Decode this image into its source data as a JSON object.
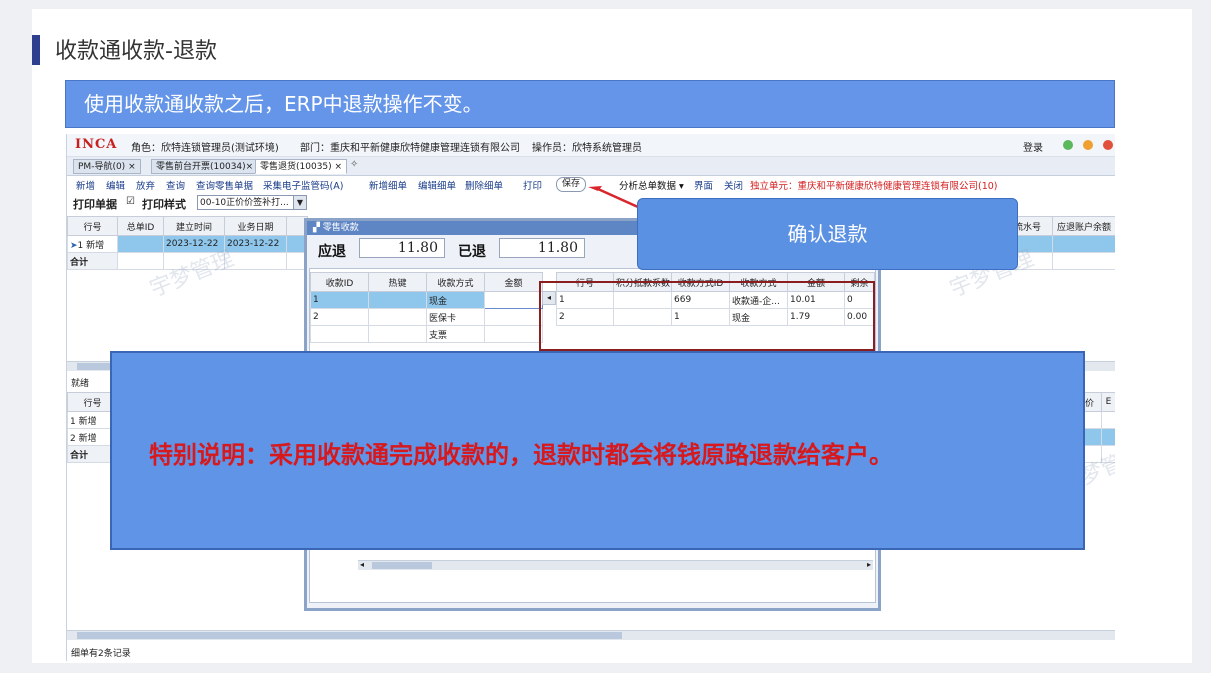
{
  "slide": {
    "title": "收款通收款-退款",
    "banner": "使用收款通收款之后，ERP中退款操作不变。",
    "callout": "确认退款",
    "note": "特别说明：采用收款通完成收款的，退款时都会将钱原路退款给客户。"
  },
  "colors": {
    "banner": "#6495e8",
    "note_text": "#d7191e",
    "logo": "#c8201e",
    "arrow": "#d9262c"
  },
  "app": {
    "logo": "INCA",
    "role": "角色：欣特连锁管理员(测试环境)",
    "dept": "部门：重庆和平新健康欣特健康管理连锁有限公司",
    "operator": "操作员：欣特系统管理员",
    "login": "登录",
    "tabs": [
      "PM-导航(0)",
      "零售前台开票(10034)",
      "零售退货(10035)"
    ],
    "toolbar": [
      "新增",
      "编辑",
      "放弃",
      "查询",
      "查询零售单据",
      "采集电子监管码(A)",
      "新增细单",
      "编辑细单",
      "删除细单",
      "打印"
    ],
    "save": "保存",
    "analysis": "分析总单数据",
    "ui": "界面",
    "close": "关闭",
    "unit": "独立单元：重庆和平新健康欣特健康管理连锁有限公司(10)",
    "print_doc": "打印单据",
    "print_style": "打印样式",
    "print_style_value": "00-10正价价签补打...",
    "watermark": "宇梦管理",
    "main_grid": {
      "headers": [
        "行号",
        "总单ID",
        "建立时间",
        "业务日期"
      ],
      "rows": [
        [
          "1 新增",
          "",
          "2023-12-22",
          "2023-12-22"
        ]
      ],
      "total": "合计",
      "right_headers": [
        "流水号",
        "应退账户余额"
      ]
    },
    "status_ready": "就绪",
    "detail_grid": {
      "headers": [
        "行号"
      ],
      "rows": [
        "1 新增",
        "2 新增"
      ],
      "total": "合计",
      "right_headers": [
        "价",
        "E"
      ]
    },
    "footer": "细单有2条记录"
  },
  "dialog": {
    "title": "零售收款",
    "refund_label": "应退",
    "refund_value": "11.80",
    "refunded_label": "已退",
    "refunded_value": "11.80",
    "left_grid": {
      "headers": [
        "收款ID",
        "热键",
        "收款方式",
        "金额"
      ],
      "rows": [
        [
          "1",
          "",
          "现金",
          ""
        ],
        [
          "2",
          "",
          "医保卡",
          ""
        ],
        [
          "",
          "",
          "支票",
          ""
        ]
      ]
    },
    "right_grid": {
      "headers": [
        "行号",
        "积分抵款系数",
        "收款方式ID",
        "收款方式",
        "金额",
        "剩余"
      ],
      "rows": [
        [
          "1",
          "",
          "669",
          "收款通-企...",
          "10.01",
          "0"
        ],
        [
          "2",
          "",
          "1",
          "现金",
          "1.79",
          "0.00"
        ]
      ]
    }
  }
}
